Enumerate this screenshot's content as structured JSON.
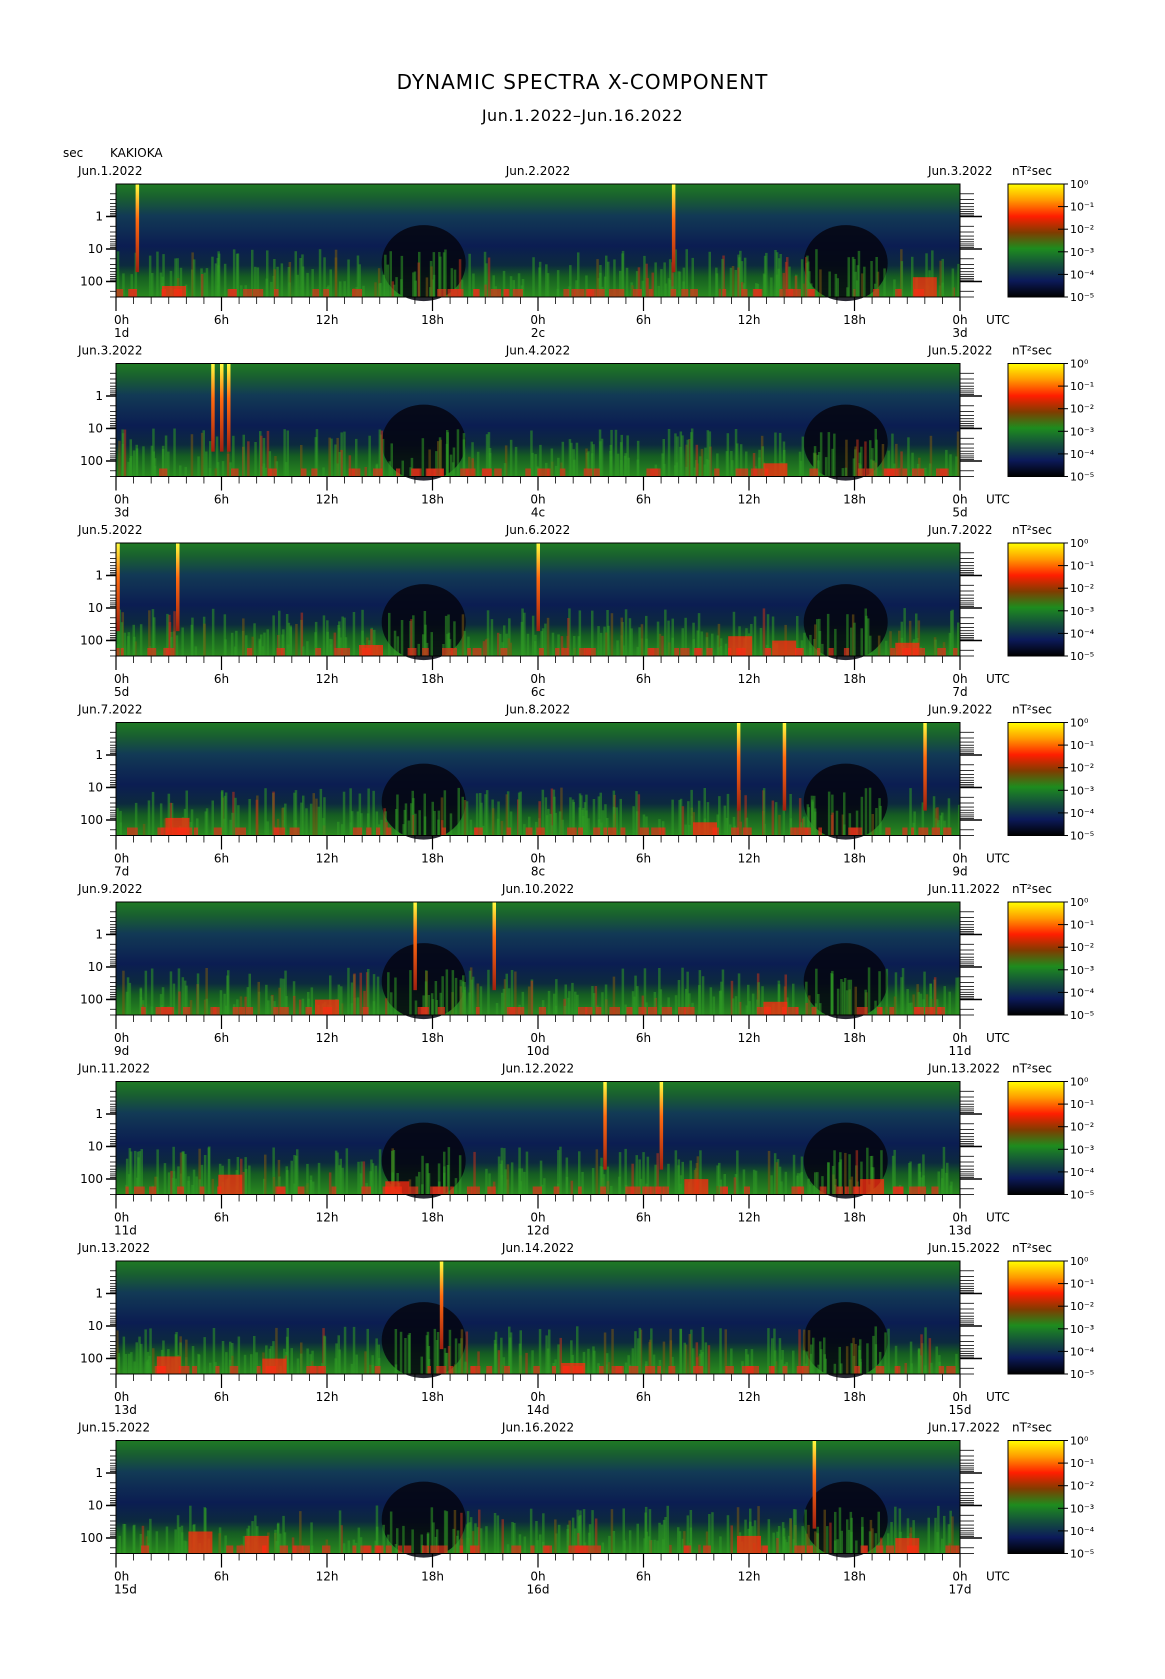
{
  "title": "DYNAMIC SPECTRA X-COMPONENT",
  "subtitle": "Jun.1.2022–Jun.16.2022",
  "station": {
    "unit": "sec",
    "name": "KAKIOKA"
  },
  "chart_data": {
    "type": "heatmap",
    "y_unit": "sec",
    "y_scale": "log",
    "y_ticks": [
      "1",
      "10",
      "100"
    ],
    "x_ticks": [
      "0h",
      "6h",
      "12h",
      "18h",
      "0h",
      "6h",
      "12h",
      "18h",
      "0h"
    ],
    "x_unit": "UTC",
    "colorbar": {
      "unit": "nT²sec",
      "ticks": [
        "10⁰",
        "10⁻¹",
        "10⁻²",
        "10⁻³",
        "10⁻⁴",
        "10⁻⁵"
      ],
      "colors": [
        "#ffff00",
        "#ff9a00",
        "#ff1e00",
        "#803c00",
        "#1e8c1e",
        "#14503c",
        "#0c1a5a",
        "#000000"
      ]
    },
    "panels": [
      {
        "start_date": "Jun.1.2022",
        "mid_date": "Jun.2.2022",
        "end_date": "Jun.3.2022",
        "day_start": "1d",
        "day_mid": "2c",
        "day_end": "3d",
        "spikes": [
          1.2,
          31.7
        ],
        "bursts": [
          {
            "t": 46.0,
            "i": 0.9
          },
          {
            "t": 3.3,
            "i": 0.5
          }
        ]
      },
      {
        "start_date": "Jun.3.2022",
        "mid_date": "Jun.4.2022",
        "end_date": "Jun.5.2022",
        "day_start": "3d",
        "day_mid": "4c",
        "day_end": "5d",
        "spikes": [
          5.5,
          6.0,
          6.4
        ],
        "bursts": [
          {
            "t": 37.5,
            "i": 0.6
          }
        ]
      },
      {
        "start_date": "Jun.5.2022",
        "mid_date": "Jun.6.2022",
        "end_date": "Jun.7.2022",
        "day_start": "5d",
        "day_mid": "6c",
        "day_end": "7d",
        "spikes": [
          0.1,
          3.5,
          24.0
        ],
        "bursts": [
          {
            "t": 14.5,
            "i": 0.5
          },
          {
            "t": 35.5,
            "i": 0.9
          },
          {
            "t": 38.0,
            "i": 0.7
          },
          {
            "t": 45.0,
            "i": 0.6
          }
        ]
      },
      {
        "start_date": "Jun.7.2022",
        "mid_date": "Jun.8.2022",
        "end_date": "Jun.9.2022",
        "day_start": "7d",
        "day_mid": "8c",
        "day_end": "9d",
        "spikes": [
          35.4,
          38.0,
          46.0
        ],
        "bursts": [
          {
            "t": 3.5,
            "i": 0.8
          },
          {
            "t": 33.5,
            "i": 0.6
          }
        ]
      },
      {
        "start_date": "Jun.9.2022",
        "mid_date": "Jun.10.2022",
        "end_date": "Jun.11.2022",
        "day_start": "9d",
        "day_mid": "10d",
        "day_end": "11d",
        "spikes": [
          17.0,
          21.5
        ],
        "bursts": [
          {
            "t": 12.0,
            "i": 0.7
          },
          {
            "t": 37.5,
            "i": 0.6
          }
        ]
      },
      {
        "start_date": "Jun.11.2022",
        "mid_date": "Jun.12.2022",
        "end_date": "Jun.13.2022",
        "day_start": "11d",
        "day_mid": "12d",
        "day_end": "13d",
        "spikes": [
          27.8,
          31.0
        ],
        "bursts": [
          {
            "t": 6.5,
            "i": 0.9
          },
          {
            "t": 16.0,
            "i": 0.6
          },
          {
            "t": 33.0,
            "i": 0.7
          },
          {
            "t": 43.0,
            "i": 0.7
          }
        ]
      },
      {
        "start_date": "Jun.13.2022",
        "mid_date": "Jun.14.2022",
        "end_date": "Jun.15.2022",
        "day_start": "13d",
        "day_mid": "14d",
        "day_end": "15d",
        "spikes": [
          18.5
        ],
        "bursts": [
          {
            "t": 3.0,
            "i": 0.8
          },
          {
            "t": 9.0,
            "i": 0.7
          },
          {
            "t": 26.0,
            "i": 0.5
          }
        ]
      },
      {
        "start_date": "Jun.15.2022",
        "mid_date": "Jun.16.2022",
        "end_date": "Jun.17.2022",
        "day_start": "15d",
        "day_mid": "16d",
        "day_end": "17d",
        "spikes": [
          39.7
        ],
        "bursts": [
          {
            "t": 4.8,
            "i": 1.0
          },
          {
            "t": 8.0,
            "i": 0.8
          },
          {
            "t": 36.0,
            "i": 0.8
          },
          {
            "t": 45.0,
            "i": 0.7
          }
        ]
      }
    ]
  }
}
